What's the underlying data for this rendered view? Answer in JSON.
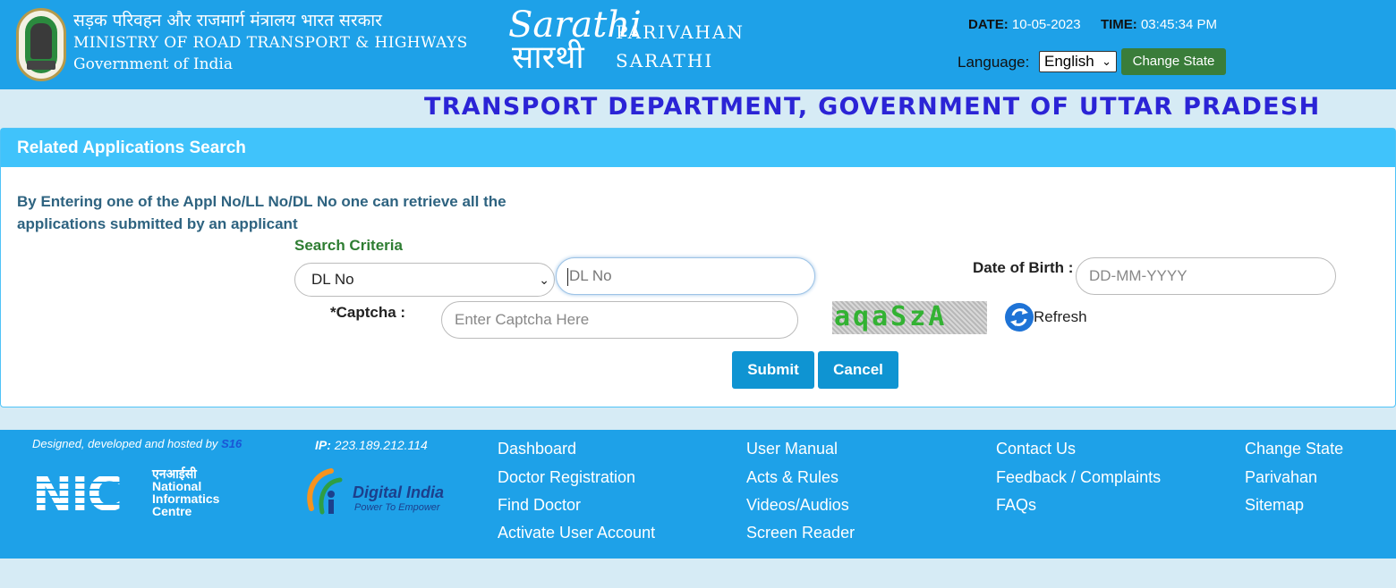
{
  "header": {
    "ministry_hindi": "सड़क परिवहन और राजमार्ग मंत्रालय भारत सरकार",
    "ministry_english": "MINISTRY OF ROAD TRANSPORT & HIGHWAYS",
    "government": "Government of India",
    "sarathi_logo_en": "Sarathi",
    "sarathi_logo_hi": "सारथी",
    "brand_line1": "PARIVAHAN",
    "brand_line2": "SARATHI",
    "date_label": "DATE:",
    "date_value": "10-05-2023",
    "time_label": "TIME:",
    "time_value": "03:45:34 PM",
    "language_label": "Language:",
    "language_selected": "English",
    "change_state_label": "Change State",
    "department": "TRANSPORT DEPARTMENT, GOVERNMENT OF UTTAR PRADESH"
  },
  "panel": {
    "title": "Related Applications Search",
    "intro": "By Entering one of the Appl No/LL No/DL No one can retrieve all the applications submitted by an applicant",
    "criteria_label": "Search Criteria",
    "criteria_selected": "DL No",
    "dl_placeholder": "DL No",
    "dob_label": "Date of Birth :",
    "dob_placeholder": "DD-MM-YYYY",
    "captcha_label": "*Captcha :",
    "captcha_placeholder": "Enter Captcha Here",
    "captcha_text": "aqaSzA",
    "refresh_label": "Refresh",
    "submit_label": "Submit",
    "cancel_label": "Cancel"
  },
  "footer": {
    "designed_text": "Designed, developed and hosted by",
    "designed_highlight": "S16",
    "ip_label": "IP:",
    "ip_value": "223.189.212.114",
    "nic_hindi": "एनआईसी",
    "nic_line1": "National",
    "nic_line2": "Informatics",
    "nic_line3": "Centre",
    "digital_india": "Digital India",
    "digital_india_tagline": "Power To Empower",
    "links_col1": [
      "Dashboard",
      "Doctor Registration",
      "Find Doctor",
      "Activate User Account"
    ],
    "links_col2": [
      "User Manual",
      "Acts & Rules",
      "Videos/Audios",
      "Screen Reader"
    ],
    "links_col3": [
      "Contact Us",
      "Feedback / Complaints",
      "FAQs"
    ],
    "links_col4": [
      "Change State",
      "Parivahan",
      "Sitemap"
    ]
  },
  "colors": {
    "header_bg": "#1ea1e8",
    "panel_head_bg": "#40c3fb",
    "department_text": "#2b24d6",
    "button_bg": "#0f94d2",
    "change_state_bg": "#3a7d3a",
    "criteria_text": "#2e7d32"
  },
  "icons": {
    "emblem": "national-emblem-icon",
    "refresh": "refresh-icon",
    "dropdown": "chevron-down-icon"
  }
}
